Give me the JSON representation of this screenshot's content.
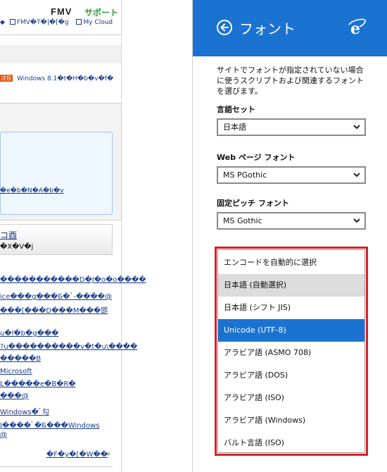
{
  "left_page": {
    "logo": "FMV",
    "support": "サポート",
    "top_links": [
      "◆",
      "FMV�T�|�[�g",
      "My Cloud"
    ],
    "news_badge": "注目",
    "news_text": "Windows 8.1�t�H�b�v�f�",
    "panel_link": "�e�b�N�A�b�v",
    "item_link": "コ⾣",
    "item_sub": "�X�V�j",
    "garbled_lines": [
      "�����������D�J�o�o����",
      "ice���g���Б�ﾞ-����@",
      "���[���D���M���邯",
      "u�l�b�g���",
      "?u����������v�t�u\\����",
      "�����B",
      "Microsoft",
      "L�����e�B�R�",
      "���@",
      "Windows�ﾞ勾",
      "J����ﾞ�Б���Windows",
      "@"
    ],
    "more_link": "�F�y�[�W��",
    "more_arrow": "»"
  },
  "flyout": {
    "title": "フォント",
    "back_icon": "back-arrow-icon",
    "browser_icon": "ie-logo-icon",
    "description": "サイトでフォントが指定されていない場合に使うスクリプトおよび関連するフォントを選びます。",
    "charset_label": "言語セット",
    "charset_value": "日本語",
    "web_font_label": "Web ページ フォント",
    "web_font_value": "MS PGothic",
    "fixed_font_label": "固定ピッチ フォント",
    "fixed_font_value": "MS Gothic",
    "encoding_options": [
      "エンコードを自動的に選択",
      "日本語 (自動選択)",
      "日本語 (シフト JIS)",
      "Unicode (UTF-8)",
      "アラビア語 (ASMO 708)",
      "アラビア語 (DOS)",
      "アラビア語 (ISO)",
      "アラビア語 (Windows)",
      "バルト言語 (ISO)"
    ],
    "hover_option": "日本語 (自動選択)",
    "selected_option": "Unicode (UTF-8)",
    "colors": {
      "accent": "#1b73d1",
      "highlight_frame": "#d4202a",
      "hover": "#dcdcdc"
    }
  }
}
